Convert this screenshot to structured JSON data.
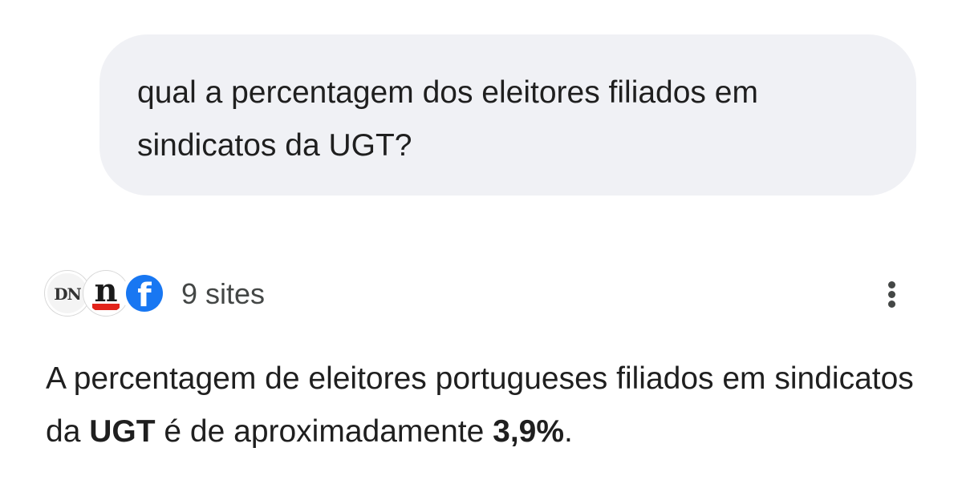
{
  "user_message": {
    "text": "qual a percentagem dos eleitores filiados em sindicatos da UGT?"
  },
  "sources": {
    "icons": [
      {
        "name": "DN",
        "icon": "dn-logo-icon"
      },
      {
        "name": "negocios.pt",
        "icon": "negocios-logo-icon"
      },
      {
        "name": "Facebook",
        "icon": "facebook-logo-icon"
      }
    ],
    "dn_logo_text": "DN",
    "negocios_logo_text": "n",
    "facebook_logo_text": "f",
    "count_label": "9 sites",
    "more_icon": "more-vert-icon"
  },
  "answer": {
    "part1": "A percentagem de eleitores portugueses filiados em sindicatos da ",
    "bold1": "UGT",
    "part2": " é de aproximadamente ",
    "bold2": "3,9%",
    "part3": "."
  },
  "colors": {
    "bubble_bg": "#f0f1f5",
    "text": "#1f1f1f",
    "muted_text": "#444746",
    "facebook_blue": "#1877f2",
    "negocios_red": "#e2231a"
  }
}
